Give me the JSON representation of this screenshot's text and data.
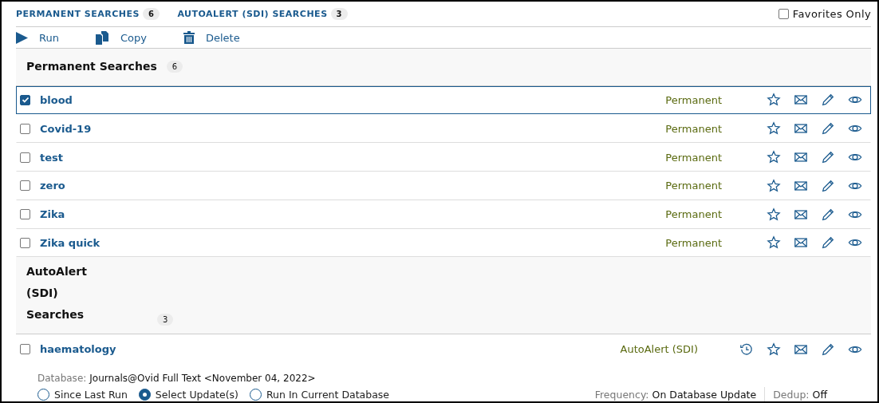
{
  "tabs": [
    {
      "label": "PERMANENT SEARCHES",
      "count": "6"
    },
    {
      "label": "AUTOALERT (SDI) SEARCHES",
      "count": "3"
    }
  ],
  "favorites_only": {
    "label": "Favorites Only",
    "checked": false
  },
  "toolbar": [
    {
      "kind": "run",
      "label": "Run"
    },
    {
      "kind": "copy",
      "label": "Copy"
    },
    {
      "kind": "delete",
      "label": "Delete"
    }
  ],
  "sections": [
    {
      "kind": "permanent",
      "title": "Permanent Searches",
      "count": "6",
      "rows": [
        {
          "name": "blood",
          "status": "Permanent",
          "checked": true
        },
        {
          "name": "Covid-19",
          "status": "Permanent",
          "checked": false
        },
        {
          "name": "test",
          "status": "Permanent",
          "checked": false
        },
        {
          "name": "zero",
          "status": "Permanent",
          "checked": false
        },
        {
          "name": "Zika",
          "status": "Permanent",
          "checked": false
        },
        {
          "name": "Zika quick",
          "status": "Permanent",
          "checked": false
        }
      ]
    },
    {
      "kind": "autoalert",
      "title": "AutoAlert (SDI) Searches",
      "count": "3",
      "rows": [
        {
          "name": "haematology",
          "status": "AutoAlert (SDI)",
          "checked": false,
          "database": {
            "label": "Database:",
            "value": "Journals@Ovid Full Text <November 04, 2022>"
          },
          "options": [
            {
              "label": "Since Last Run",
              "selected": false
            },
            {
              "label": "Select Update(s)",
              "selected": true
            },
            {
              "label": "Run In Current Database",
              "selected": false
            }
          ],
          "frequency": {
            "label": "Frequency:",
            "value": "On Database Update"
          },
          "dedup": {
            "label": "Dedup:",
            "value": "Off"
          }
        }
      ]
    }
  ]
}
